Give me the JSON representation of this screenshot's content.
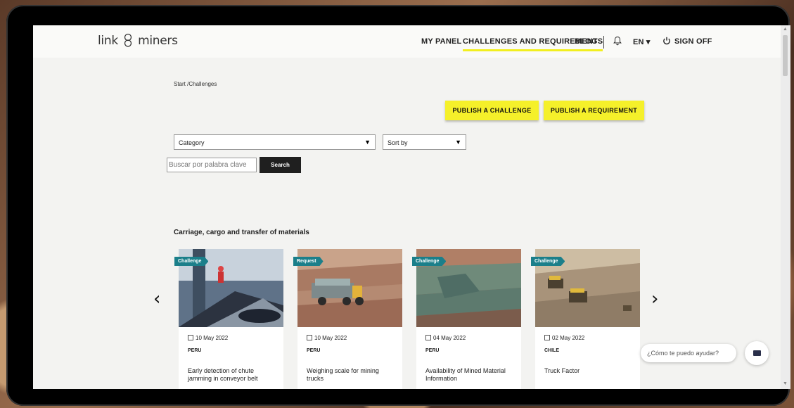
{
  "logo": {
    "left": "link",
    "right": "miners"
  },
  "nav": {
    "my_panel": "MY PANEL",
    "challenges": "CHALLENGES AND REQUIREMENTS",
    "blog": "BLOG",
    "lang": "EN ▾",
    "sign_off": "SIGN OFF"
  },
  "breadcrumb": "Start /Challenges",
  "actions": {
    "publish_challenge": "PUBLISH A CHALLENGE",
    "publish_requirement": "PUBLISH A REQUIREMENT"
  },
  "filters": {
    "category": "Category",
    "sort": "Sort by",
    "caret": "▼"
  },
  "search": {
    "placeholder": "Buscar por palabra clave",
    "button": "Search"
  },
  "section": {
    "title": "Carriage, cargo and transfer of materials"
  },
  "carousel": {
    "prev": "‹",
    "next": "›"
  },
  "cards": [
    {
      "tag": "Challenge",
      "date": "10 May 2022",
      "country": "PERU",
      "title": "Early detection of chute jamming in conveyor belt"
    },
    {
      "tag": "Request",
      "date": "10 May 2022",
      "country": "PERU",
      "title": "Weighing scale for mining trucks"
    },
    {
      "tag": "Challenge",
      "date": "04 May 2022",
      "country": "PERU",
      "title": "Availability of Mined Material Information"
    },
    {
      "tag": "Challenge",
      "date": "02 May 2022",
      "country": "CHILE",
      "title": "Truck Factor"
    }
  ],
  "chat": {
    "prompt": "¿Cómo te puedo ayudar?"
  },
  "colors": {
    "accent": "#f5f02a",
    "tag": "#1b7f8a",
    "dark": "#1f1f1f"
  }
}
